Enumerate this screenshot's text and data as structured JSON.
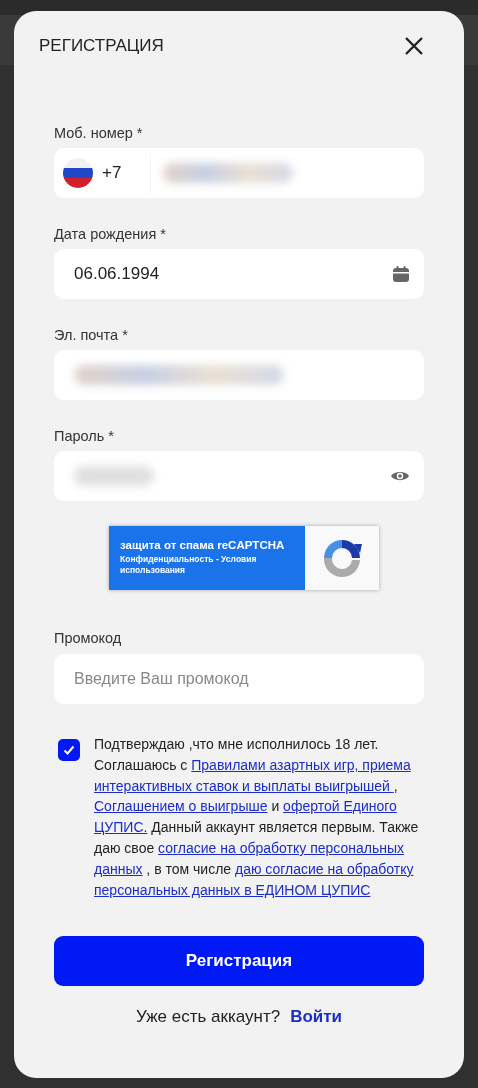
{
  "modal": {
    "title": "РЕГИСТРАЦИЯ"
  },
  "phone": {
    "label": "Моб. номер *",
    "code": "+7"
  },
  "birth_date": {
    "label": "Дата рождения *",
    "value": "06.06.1994"
  },
  "email": {
    "label": "Эл. почта *"
  },
  "password": {
    "label": "Пароль *"
  },
  "recaptcha": {
    "title": "защита от спама reCAPTCHA",
    "links": "Конфиденциальность - Условия использования"
  },
  "promo": {
    "label": "Промокод",
    "placeholder": "Введите Ваш промокод"
  },
  "consent": {
    "checked": true,
    "parts": [
      {
        "kind": "text",
        "text": "Подтверждаю ,что мне исполнилось 18 лет. Соглашаюсь с "
      },
      {
        "kind": "link",
        "text": "Правилами азартных игр, приема интерактивных ставок и выплаты выигрышей "
      },
      {
        "kind": "text",
        "text": ", "
      },
      {
        "kind": "link",
        "text": "Соглашением о выигрыше"
      },
      {
        "kind": "text",
        "text": "  и "
      },
      {
        "kind": "link",
        "text": "офертой Единого ЦУПИС."
      },
      {
        "kind": "text",
        "text": " Данный аккаунт является первым. Также даю свое "
      },
      {
        "kind": "link",
        "text": "согласие на обработку персональных данных"
      },
      {
        "kind": "text",
        "text": " , в том числе "
      },
      {
        "kind": "link",
        "text": "даю согласие на обработку персональных данных в ЕДИНОМ  ЦУПИС"
      }
    ]
  },
  "submit": {
    "label": "Регистрация"
  },
  "login": {
    "prompt": "Уже есть аккаунт?",
    "link": "Войти"
  }
}
